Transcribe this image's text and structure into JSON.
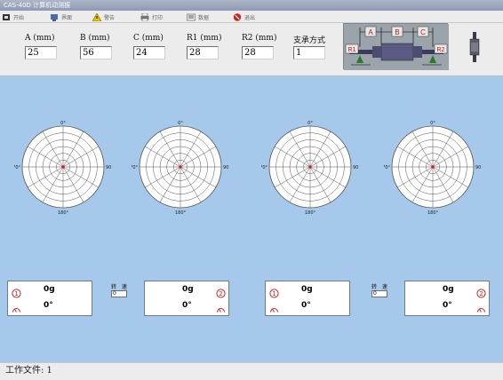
{
  "window": {
    "title": "CAS-40D 计算机动测振"
  },
  "toolbar": {
    "items": [
      {
        "label": "开始",
        "icon": "start-icon"
      },
      {
        "label": "界面",
        "icon": "screen-icon"
      },
      {
        "label": "警告",
        "icon": "warning-icon"
      },
      {
        "label": "打印",
        "icon": "print-icon"
      },
      {
        "label": "数据",
        "icon": "data-icon"
      },
      {
        "label": "退出",
        "icon": "exit-icon"
      }
    ]
  },
  "params": {
    "a": {
      "label": "A (mm)",
      "value": "25"
    },
    "b": {
      "label": "B (mm)",
      "value": "56"
    },
    "c": {
      "label": "C (mm)",
      "value": "24"
    },
    "r1": {
      "label": "R1 (mm)",
      "value": "28"
    },
    "r2": {
      "label": "R2 (mm)",
      "value": "28"
    },
    "support": {
      "label": "支承方式",
      "value": "1"
    }
  },
  "diagram": {
    "a": "A",
    "b": "B",
    "c": "C",
    "r1": "R1",
    "r2": "R2"
  },
  "polar": {
    "top": "0°",
    "right": "90°",
    "bottom": "180°",
    "left": "270°"
  },
  "speed": [
    {
      "label": "转 速",
      "value": "0"
    },
    {
      "label": "转 速",
      "value": "0"
    }
  ],
  "results": [
    {
      "plane": "1",
      "amount": "0g",
      "angle": "0°"
    },
    {
      "plane": "2",
      "amount": "0g",
      "angle": "0°"
    },
    {
      "plane": "1",
      "amount": "0g",
      "angle": "0°"
    },
    {
      "plane": "2",
      "amount": "0g",
      "angle": "0°"
    }
  ],
  "status": {
    "text": "工作文件: 1"
  },
  "colors": {
    "background": "#a6c8ea",
    "panel": "#ececec",
    "marker": "#d42020"
  }
}
